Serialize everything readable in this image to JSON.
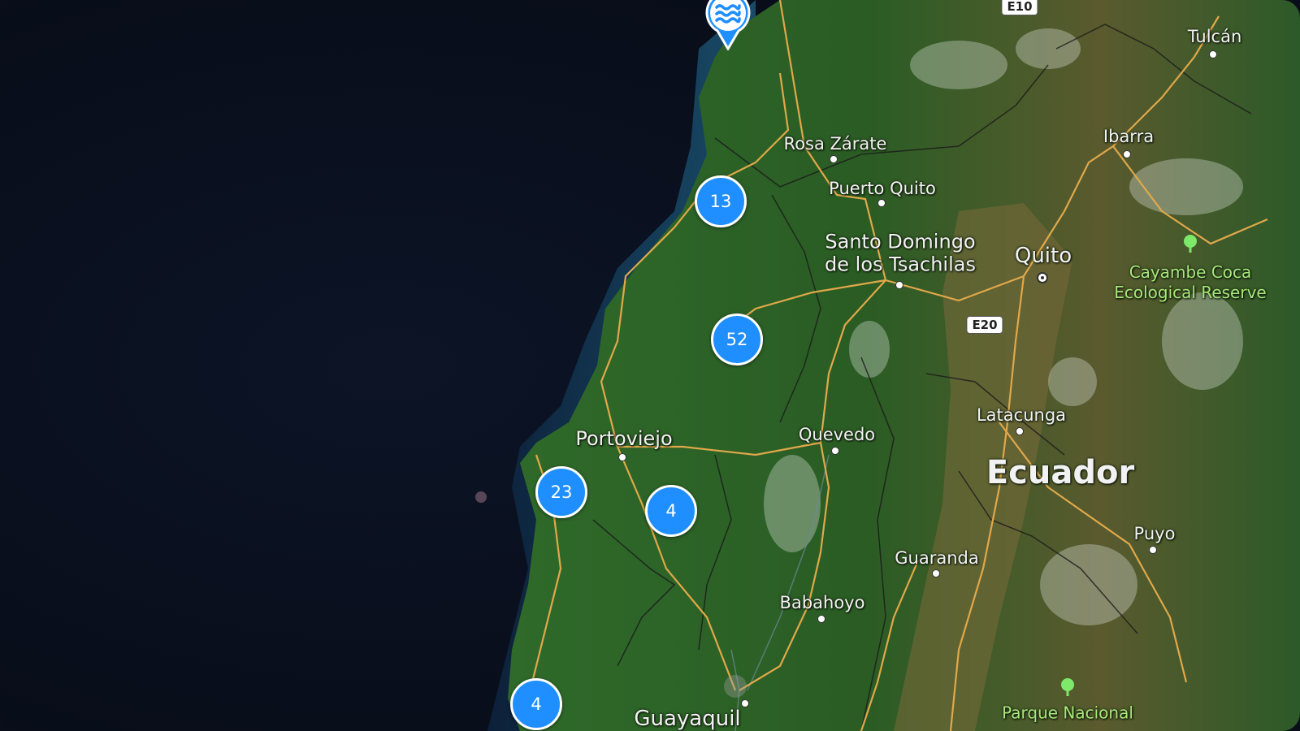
{
  "map": {
    "country_label": "Ecuador",
    "cities": [
      {
        "id": "tulcan",
        "name": "Tulcán"
      },
      {
        "id": "rosa-zarate",
        "name": "Rosa Zárate"
      },
      {
        "id": "ibarra",
        "name": "Ibarra"
      },
      {
        "id": "puerto-quito",
        "name": "Puerto Quito"
      },
      {
        "id": "santo-domingo",
        "name": "Santo Domingo de los Tsachilas"
      },
      {
        "id": "quito",
        "name": "Quito"
      },
      {
        "id": "portoviejo",
        "name": "Portoviejo"
      },
      {
        "id": "quevedo",
        "name": "Quevedo"
      },
      {
        "id": "latacunga",
        "name": "Latacunga"
      },
      {
        "id": "puyo",
        "name": "Puyo"
      },
      {
        "id": "guaranda",
        "name": "Guaranda"
      },
      {
        "id": "babahoyo",
        "name": "Babahoyo"
      },
      {
        "id": "guayaquil",
        "name": "Guayaquil"
      }
    ],
    "parks": [
      {
        "id": "cayambe-coca",
        "name": "Cayambe Coca Ecological Reserve"
      },
      {
        "id": "parque-nacional",
        "name": "Parque Nacional"
      }
    ],
    "road_shields": [
      "E10",
      "E20"
    ],
    "clusters": [
      "13",
      "52",
      "23",
      "4",
      "4"
    ],
    "pin_icon": "water-waves-icon",
    "colors": {
      "cluster_fill": "#1f8fff",
      "ocean": "#0a0e1a",
      "land": "#2e5a26",
      "roads": "#e0a84a",
      "park_label": "#a8e87a"
    }
  }
}
